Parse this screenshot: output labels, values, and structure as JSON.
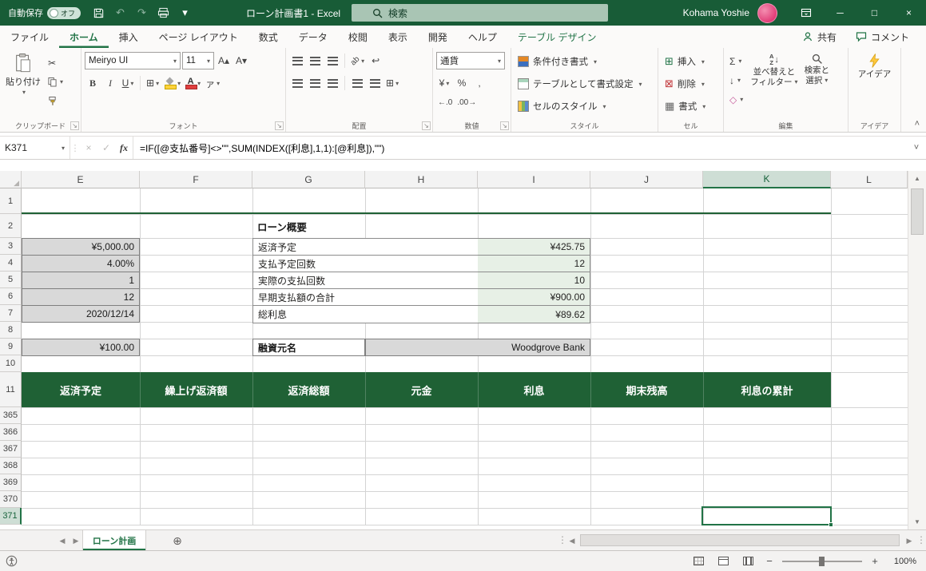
{
  "colors": {
    "accent_green": "#217346",
    "titlebar_green": "#185C37",
    "table_header_green": "#1F6135",
    "summary_value_bg": "#E7F0E6",
    "input_cell_gray": "#D9D9D9"
  },
  "icons": {
    "caret_down": "▾",
    "collapse": "˄",
    "expand": "˅",
    "undo": "↶",
    "redo": "↷",
    "minimize": "─",
    "maximize": "□",
    "close": "×",
    "check": "✓",
    "scissors": "✂",
    "bold": "B",
    "italic": "I",
    "underline": "U",
    "borders": "⊞",
    "merge": "⊞",
    "grow_font": "A▴",
    "shrink_font": "A▾",
    "phonetic": "ァ",
    "orientation": "ab",
    "wrap": "↩",
    "currency": "¥",
    "percent": "%",
    "comma": ",",
    "inc_decimal": "←.0",
    "dec_decimal": ".00→",
    "autosum": "Σ",
    "fill_down": "↓",
    "clear": "◇",
    "letter_a": "A",
    "letter_z": "Z",
    "arrow_down": "↓",
    "insert_cells": "⊞",
    "delete_cells": "⊠",
    "format_cells": "▦",
    "corner_triangle": "◢",
    "left_arrow": "◀",
    "right_arrow": "▶",
    "up_arrow": "▲",
    "down_arrow": "▼",
    "add_sheet": "⊕",
    "splitter": "⋮",
    "zoom_in": "+",
    "zoom_out": "−",
    "launcher": "↘"
  },
  "titlebar": {
    "autosave_label": "自動保存",
    "autosave_state": "オフ",
    "doc_title": "ローン計画書1 -  Excel",
    "search_placeholder": "検索",
    "user_name": "Kohama Yoshie"
  },
  "ribbon_tabs": {
    "file": "ファイル",
    "home": "ホーム",
    "insert": "挿入",
    "page_layout": "ページ レイアウト",
    "formulas": "数式",
    "data": "データ",
    "review": "校閲",
    "view": "表示",
    "developer": "開発",
    "help": "ヘルプ",
    "table_design": "テーブル デザイン",
    "share": "共有",
    "comments": "コメント"
  },
  "ribbon": {
    "groups": {
      "clipboard": "クリップボード",
      "font": "フォント",
      "alignment": "配置",
      "number": "数値",
      "styles": "スタイル",
      "cells": "セル",
      "editing": "編集",
      "ideas": "アイデア"
    },
    "paste_label": "貼り付け",
    "font_name": "Meiryo UI",
    "font_size": "11",
    "number_format": "通貨",
    "conditional_formatting": "条件付き書式",
    "format_as_table": "テーブルとして書式設定",
    "cell_styles": "セルのスタイル",
    "insert_label": "挿入",
    "delete_label": "削除",
    "format_label": "書式",
    "sort_filter_1": "並べ替えと",
    "sort_filter_2": "フィルター",
    "find_select_1": "検索と",
    "find_select_2": "選択",
    "ideas_label": "アイデア"
  },
  "formula_bar": {
    "name_box": "K371",
    "fx": "fx",
    "formula": "=IF([@支払番号]<>\"\",SUM(INDEX([利息],1,1):[@利息]),\"\")"
  },
  "grid": {
    "columns": [
      "E",
      "F",
      "G",
      "H",
      "I",
      "J",
      "K",
      "L"
    ],
    "row_numbers_top": [
      "1",
      "2",
      "3",
      "4",
      "5",
      "6",
      "7",
      "8",
      "9",
      "10",
      "11"
    ],
    "row_numbers_bottom": [
      "365",
      "366",
      "367",
      "368",
      "369",
      "370",
      "371"
    ],
    "summary_title": "ローン概要",
    "col_e_values": {
      "r3": "¥5,000.00",
      "r4": "4.00%",
      "r5": "1",
      "r6": "12",
      "r7": "2020/12/14",
      "r9": "¥100.00"
    },
    "summary": [
      {
        "label": "返済予定",
        "value": "¥425.75"
      },
      {
        "label": "支払予定回数",
        "value": "12"
      },
      {
        "label": "実際の支払回数",
        "value": "10"
      },
      {
        "label": "早期支払額の合計",
        "value": "¥900.00"
      },
      {
        "label": "総利息",
        "value": "¥89.62"
      }
    ],
    "lender_label": "融資元名",
    "lender_value": "Woodgrove Bank",
    "table_headers": [
      "返済予定",
      "繰上げ返済額",
      "返済総額",
      "元金",
      "利息",
      "期末残高",
      "利息の累計"
    ]
  },
  "sheet_bar": {
    "active_tab": "ローン計画"
  },
  "status_bar": {
    "zoom_level": "100%"
  }
}
